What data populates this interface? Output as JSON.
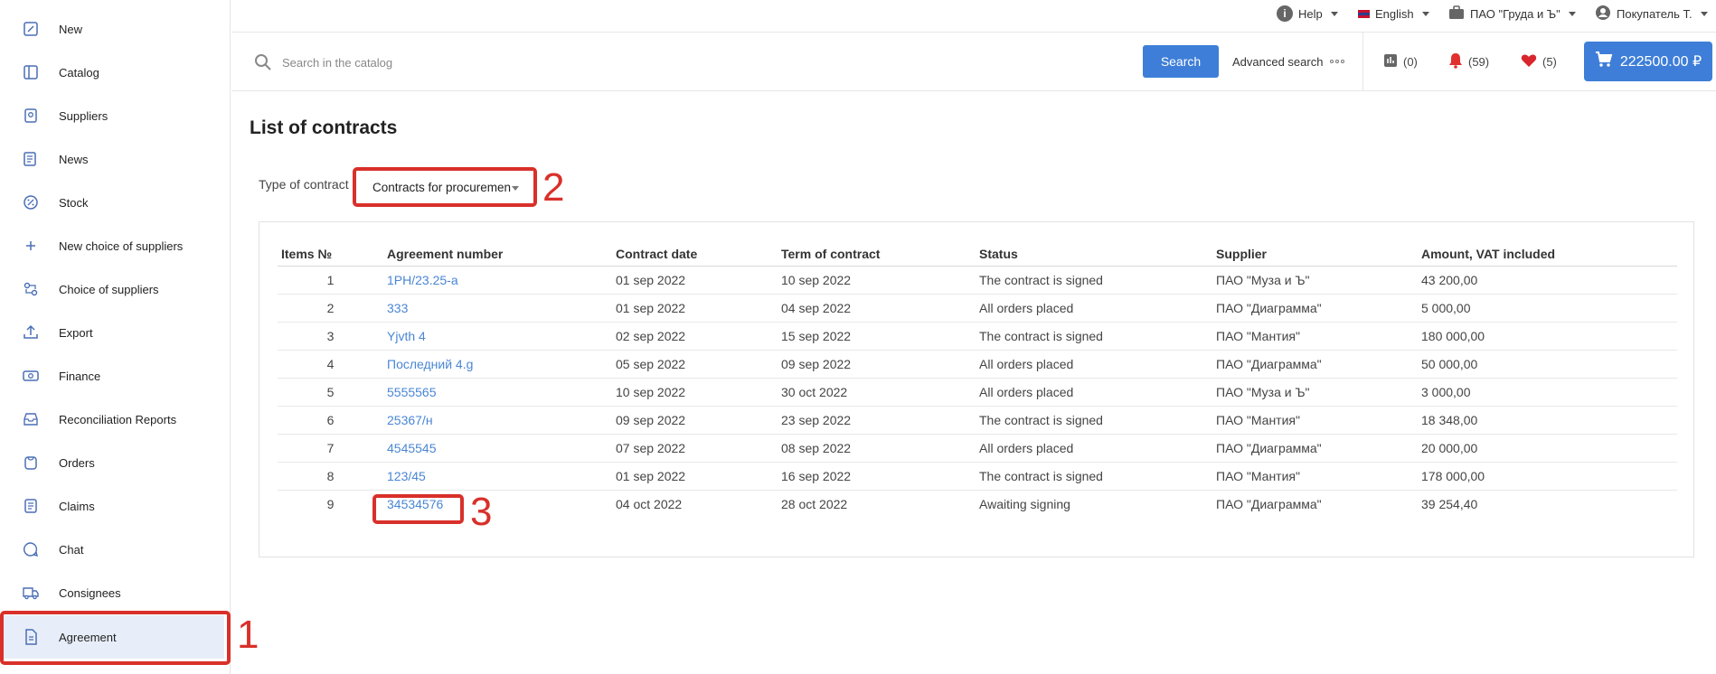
{
  "sidebar": {
    "items": [
      {
        "label": "New",
        "icon": "new-icon"
      },
      {
        "label": "Catalog",
        "icon": "catalog-icon"
      },
      {
        "label": "Suppliers",
        "icon": "suppliers-icon"
      },
      {
        "label": "News",
        "icon": "news-icon"
      },
      {
        "label": "Stock",
        "icon": "stock-icon"
      },
      {
        "label": "New choice of suppliers",
        "icon": "plus-icon"
      },
      {
        "label": "Choice of suppliers",
        "icon": "choice-icon"
      },
      {
        "label": "Export",
        "icon": "export-icon"
      },
      {
        "label": "Finance",
        "icon": "finance-icon"
      },
      {
        "label": "Reconciliation Reports",
        "icon": "reports-icon"
      },
      {
        "label": "Orders",
        "icon": "orders-icon"
      },
      {
        "label": "Claims",
        "icon": "claims-icon"
      },
      {
        "label": "Chat",
        "icon": "chat-icon"
      },
      {
        "label": "Consignees",
        "icon": "truck-icon"
      },
      {
        "label": "Agreement",
        "icon": "document-icon"
      }
    ],
    "active": "Agreement"
  },
  "topbar": {
    "help": "Help",
    "language": "English",
    "company": "ПАО \"Груда и Ъ\"",
    "user": "Покупатель Т."
  },
  "search": {
    "placeholder": "Search in the catalog",
    "button": "Search",
    "advanced": "Advanced search"
  },
  "counters": {
    "compare": "(0)",
    "notifications": "(59)",
    "favorites": "(5)"
  },
  "cart": {
    "amount": "222500.00 ₽"
  },
  "page": {
    "title": "List of contracts",
    "type_label": "Type of contract",
    "type_value": "Contracts for procuremen"
  },
  "table": {
    "headers": [
      "Items №",
      "Agreement number",
      "Contract date",
      "Term of contract",
      "Status",
      "Supplier",
      "Amount, VAT included"
    ],
    "rows": [
      {
        "n": "1",
        "agreement": "1РН/23.25-а",
        "date": "01 sep 2022",
        "term": "10 sep 2022",
        "status": "The contract is signed",
        "supplier": "ПАО \"Муза и Ъ\"",
        "amount": "43 200,00"
      },
      {
        "n": "2",
        "agreement": "333",
        "date": "01 sep 2022",
        "term": "04 sep 2022",
        "status": "All orders placed",
        "supplier": "ПАО \"Диаграмма\"",
        "amount": "5 000,00"
      },
      {
        "n": "3",
        "agreement": "Yjvth 4",
        "date": "02 sep 2022",
        "term": "15 sep 2022",
        "status": "The contract is signed",
        "supplier": "ПАО \"Мантия\"",
        "amount": "180 000,00"
      },
      {
        "n": "4",
        "agreement": "Последний 4.g",
        "date": "05 sep 2022",
        "term": "09 sep 2022",
        "status": "All orders placed",
        "supplier": "ПАО \"Диаграмма\"",
        "amount": "50 000,00"
      },
      {
        "n": "5",
        "agreement": "5555565",
        "date": "10 sep 2022",
        "term": "30 oct 2022",
        "status": "All orders placed",
        "supplier": "ПАО \"Муза и Ъ\"",
        "amount": "3 000,00"
      },
      {
        "n": "6",
        "agreement": "25367/н",
        "date": "09 sep 2022",
        "term": "23 sep 2022",
        "status": "The contract is signed",
        "supplier": "ПАО \"Мантия\"",
        "amount": "18 348,00"
      },
      {
        "n": "7",
        "agreement": "4545545",
        "date": "07 sep 2022",
        "term": "08 sep 2022",
        "status": "All orders placed",
        "supplier": "ПАО \"Диаграмма\"",
        "amount": "20 000,00"
      },
      {
        "n": "8",
        "agreement": "123/45",
        "date": "01 sep 2022",
        "term": "16 sep 2022",
        "status": "The contract is signed",
        "supplier": "ПАО \"Мантия\"",
        "amount": "178 000,00"
      },
      {
        "n": "9",
        "agreement": "34534576",
        "date": "04 oct 2022",
        "term": "28 oct 2022",
        "status": "Awaiting signing",
        "supplier": "ПАО \"Диаграмма\"",
        "amount": "39 254,40"
      }
    ]
  },
  "annotations": [
    "1",
    "2",
    "3"
  ],
  "colors": {
    "accent": "#3e7ed8",
    "link": "#4a86d4",
    "annotation": "#d9302a",
    "active_bg": "#e8eef9"
  }
}
